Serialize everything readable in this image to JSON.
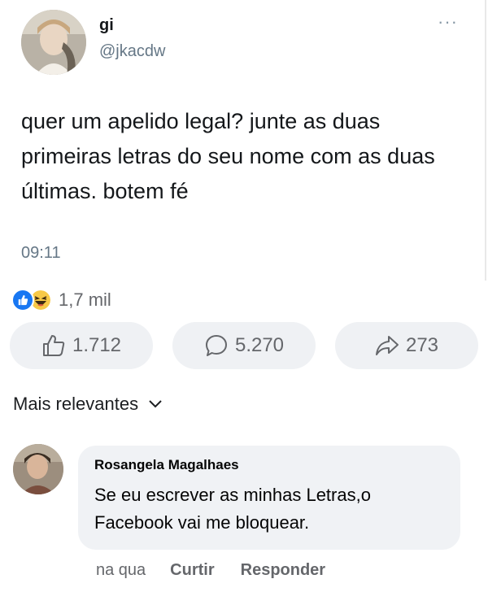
{
  "tweet": {
    "name": "gi",
    "handle": "@jkacdw",
    "more_glyph": "···",
    "text": "quer um apelido legal? junte as duas primeiras letras do seu nome com as duas últimas. botem fé",
    "time": "09:11"
  },
  "reactions": {
    "icons": [
      "like-icon",
      "haha-icon"
    ],
    "count": "1,7 mil"
  },
  "actions": {
    "like_count": "1.712",
    "comment_count": "5.270",
    "share_count": "273"
  },
  "sort": {
    "label": "Mais relevantes"
  },
  "comment": {
    "author": "Rosangela Magalhaes",
    "text": "Se eu escrever as minhas Letras,o Facebook vai me bloquear.",
    "time": "na qua",
    "like_label": "Curtir",
    "reply_label": "Responder"
  },
  "colors": {
    "like_blue": "#1877f2",
    "haha_yellow": "#f7c948",
    "pill_bg": "#eff1f4",
    "bubble_bg": "#f0f2f5",
    "secondary_text": "#65676b"
  }
}
